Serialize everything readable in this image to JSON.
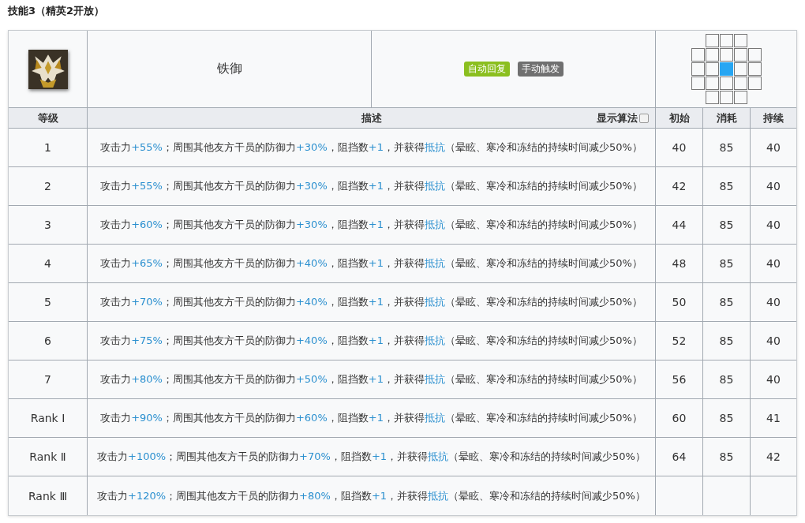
{
  "title": "技能3（精英2开放）",
  "skill": {
    "name": "铁御",
    "tags": [
      {
        "label": "自动回复",
        "color": "#8bbf1f"
      },
      {
        "label": "手动触发",
        "color": "#707070"
      }
    ],
    "range": [
      {
        "cells": [
          {
            "kind": "none"
          },
          {
            "kind": "range"
          },
          {
            "kind": "range"
          },
          {
            "kind": "range"
          },
          {
            "kind": "none"
          }
        ]
      },
      {
        "cells": [
          {
            "kind": "range"
          },
          {
            "kind": "range"
          },
          {
            "kind": "range"
          },
          {
            "kind": "range"
          },
          {
            "kind": "range"
          }
        ]
      },
      {
        "cells": [
          {
            "kind": "range"
          },
          {
            "kind": "range"
          },
          {
            "kind": "self"
          },
          {
            "kind": "range"
          },
          {
            "kind": "range"
          }
        ]
      },
      {
        "cells": [
          {
            "kind": "range"
          },
          {
            "kind": "range"
          },
          {
            "kind": "range"
          },
          {
            "kind": "range"
          },
          {
            "kind": "range"
          }
        ]
      },
      {
        "cells": [
          {
            "kind": "none"
          },
          {
            "kind": "range"
          },
          {
            "kind": "range"
          },
          {
            "kind": "range"
          },
          {
            "kind": "none"
          }
        ]
      }
    ]
  },
  "columns": {
    "level": "等级",
    "description": "描述",
    "show_formula": {
      "label": "显示算法",
      "checked": false
    },
    "initial": "初始",
    "cost": "消耗",
    "duration": "持续"
  },
  "rows": [
    {
      "level": "1",
      "description": [
        {
          "kind": "text",
          "text": "攻击力"
        },
        {
          "kind": "value",
          "text": "+55%"
        },
        {
          "kind": "text",
          "text": "；周围其他友方干员的防御力"
        },
        {
          "kind": "value",
          "text": "+30%"
        },
        {
          "kind": "text",
          "text": "，阻挡数"
        },
        {
          "kind": "value",
          "text": "+1"
        },
        {
          "kind": "text",
          "text": "，并获得"
        },
        {
          "kind": "term",
          "text": "抵抗"
        },
        {
          "kind": "text",
          "text": "（晕眩、寒冷和冻结的持续时间减少50%）"
        }
      ],
      "initial": "40",
      "cost": "85",
      "duration": "40"
    },
    {
      "level": "2",
      "description": [
        {
          "kind": "text",
          "text": "攻击力"
        },
        {
          "kind": "value",
          "text": "+55%"
        },
        {
          "kind": "text",
          "text": "；周围其他友方干员的防御力"
        },
        {
          "kind": "value",
          "text": "+30%"
        },
        {
          "kind": "text",
          "text": "，阻挡数"
        },
        {
          "kind": "value",
          "text": "+1"
        },
        {
          "kind": "text",
          "text": "，并获得"
        },
        {
          "kind": "term",
          "text": "抵抗"
        },
        {
          "kind": "text",
          "text": "（晕眩、寒冷和冻结的持续时间减少50%）"
        }
      ],
      "initial": "42",
      "cost": "85",
      "duration": "40"
    },
    {
      "level": "3",
      "description": [
        {
          "kind": "text",
          "text": "攻击力"
        },
        {
          "kind": "value",
          "text": "+60%"
        },
        {
          "kind": "text",
          "text": "；周围其他友方干员的防御力"
        },
        {
          "kind": "value",
          "text": "+30%"
        },
        {
          "kind": "text",
          "text": "，阻挡数"
        },
        {
          "kind": "value",
          "text": "+1"
        },
        {
          "kind": "text",
          "text": "，并获得"
        },
        {
          "kind": "term",
          "text": "抵抗"
        },
        {
          "kind": "text",
          "text": "（晕眩、寒冷和冻结的持续时间减少50%）"
        }
      ],
      "initial": "44",
      "cost": "85",
      "duration": "40"
    },
    {
      "level": "4",
      "description": [
        {
          "kind": "text",
          "text": "攻击力"
        },
        {
          "kind": "value",
          "text": "+65%"
        },
        {
          "kind": "text",
          "text": "；周围其他友方干员的防御力"
        },
        {
          "kind": "value",
          "text": "+40%"
        },
        {
          "kind": "text",
          "text": "，阻挡数"
        },
        {
          "kind": "value",
          "text": "+1"
        },
        {
          "kind": "text",
          "text": "，并获得"
        },
        {
          "kind": "term",
          "text": "抵抗"
        },
        {
          "kind": "text",
          "text": "（晕眩、寒冷和冻结的持续时间减少50%）"
        }
      ],
      "initial": "48",
      "cost": "85",
      "duration": "40"
    },
    {
      "level": "5",
      "description": [
        {
          "kind": "text",
          "text": "攻击力"
        },
        {
          "kind": "value",
          "text": "+70%"
        },
        {
          "kind": "text",
          "text": "；周围其他友方干员的防御力"
        },
        {
          "kind": "value",
          "text": "+40%"
        },
        {
          "kind": "text",
          "text": "，阻挡数"
        },
        {
          "kind": "value",
          "text": "+1"
        },
        {
          "kind": "text",
          "text": "，并获得"
        },
        {
          "kind": "term",
          "text": "抵抗"
        },
        {
          "kind": "text",
          "text": "（晕眩、寒冷和冻结的持续时间减少50%）"
        }
      ],
      "initial": "50",
      "cost": "85",
      "duration": "40"
    },
    {
      "level": "6",
      "description": [
        {
          "kind": "text",
          "text": "攻击力"
        },
        {
          "kind": "value",
          "text": "+75%"
        },
        {
          "kind": "text",
          "text": "；周围其他友方干员的防御力"
        },
        {
          "kind": "value",
          "text": "+40%"
        },
        {
          "kind": "text",
          "text": "，阻挡数"
        },
        {
          "kind": "value",
          "text": "+1"
        },
        {
          "kind": "text",
          "text": "，并获得"
        },
        {
          "kind": "term",
          "text": "抵抗"
        },
        {
          "kind": "text",
          "text": "（晕眩、寒冷和冻结的持续时间减少50%）"
        }
      ],
      "initial": "52",
      "cost": "85",
      "duration": "40"
    },
    {
      "level": "7",
      "description": [
        {
          "kind": "text",
          "text": "攻击力"
        },
        {
          "kind": "value",
          "text": "+80%"
        },
        {
          "kind": "text",
          "text": "；周围其他友方干员的防御力"
        },
        {
          "kind": "value",
          "text": "+50%"
        },
        {
          "kind": "text",
          "text": "，阻挡数"
        },
        {
          "kind": "value",
          "text": "+1"
        },
        {
          "kind": "text",
          "text": "，并获得"
        },
        {
          "kind": "term",
          "text": "抵抗"
        },
        {
          "kind": "text",
          "text": "（晕眩、寒冷和冻结的持续时间减少50%）"
        }
      ],
      "initial": "56",
      "cost": "85",
      "duration": "40"
    },
    {
      "level": "Rank Ⅰ",
      "description": [
        {
          "kind": "text",
          "text": "攻击力"
        },
        {
          "kind": "value",
          "text": "+90%"
        },
        {
          "kind": "text",
          "text": "；周围其他友方干员的防御力"
        },
        {
          "kind": "value",
          "text": "+60%"
        },
        {
          "kind": "text",
          "text": "，阻挡数"
        },
        {
          "kind": "value",
          "text": "+1"
        },
        {
          "kind": "text",
          "text": "，并获得"
        },
        {
          "kind": "term",
          "text": "抵抗"
        },
        {
          "kind": "text",
          "text": "（晕眩、寒冷和冻结的持续时间减少50%）"
        }
      ],
      "initial": "60",
      "cost": "85",
      "duration": "41"
    },
    {
      "level": "Rank Ⅱ",
      "description": [
        {
          "kind": "text",
          "text": "攻击力"
        },
        {
          "kind": "value",
          "text": "+100%"
        },
        {
          "kind": "text",
          "text": "；周围其他友方干员的防御力"
        },
        {
          "kind": "value",
          "text": "+70%"
        },
        {
          "kind": "text",
          "text": "，阻挡数"
        },
        {
          "kind": "value",
          "text": "+1"
        },
        {
          "kind": "text",
          "text": "，并获得"
        },
        {
          "kind": "term",
          "text": "抵抗"
        },
        {
          "kind": "text",
          "text": "（晕眩、寒冷和冻结的持续时间减少50%）"
        }
      ],
      "initial": "64",
      "cost": "85",
      "duration": "42"
    },
    {
      "level": "Rank Ⅲ",
      "description": [
        {
          "kind": "text",
          "text": "攻击力"
        },
        {
          "kind": "value",
          "text": "+120%"
        },
        {
          "kind": "text",
          "text": "；周围其他友方干员的防御力"
        },
        {
          "kind": "value",
          "text": "+80%"
        },
        {
          "kind": "text",
          "text": "，阻挡数"
        },
        {
          "kind": "value",
          "text": "+1"
        },
        {
          "kind": "text",
          "text": "，并获得"
        },
        {
          "kind": "term",
          "text": "抵抗"
        },
        {
          "kind": "text",
          "text": "（晕眩、寒冷和冻结的持续时间减少50%）"
        }
      ]
    }
  ]
}
